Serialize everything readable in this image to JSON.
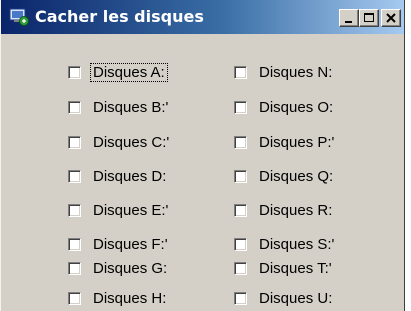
{
  "window": {
    "title": "Cacher les disques",
    "controls": [
      "minimize-icon",
      "maximize-icon",
      "close-icon"
    ]
  },
  "checkboxes": {
    "left": [
      {
        "label": "Disques A:",
        "checked": false,
        "focused": true
      },
      {
        "label": "Disques B:'",
        "checked": false
      },
      {
        "label": "Disques C:'",
        "checked": false
      },
      {
        "label": "Disques D:",
        "checked": false
      },
      {
        "label": "Disques E:'",
        "checked": false
      },
      {
        "label": "Disques F:'",
        "checked": false
      },
      {
        "label": "Disques G:",
        "checked": false
      },
      {
        "label": "Disques H:",
        "checked": false
      }
    ],
    "right": [
      {
        "label": "Disques N:",
        "checked": false
      },
      {
        "label": "Disques O:",
        "checked": false
      },
      {
        "label": "Disques P:'",
        "checked": false
      },
      {
        "label": "Disques Q:",
        "checked": false
      },
      {
        "label": "Disques R:",
        "checked": false
      },
      {
        "label": "Disques S:'",
        "checked": false
      },
      {
        "label": "Disques T:'",
        "checked": false
      },
      {
        "label": "Disques U:",
        "checked": false
      }
    ]
  },
  "colors": {
    "titlebar_start": "#0a246a",
    "titlebar_end": "#a6caf0",
    "window_face": "#d4d0c8"
  }
}
